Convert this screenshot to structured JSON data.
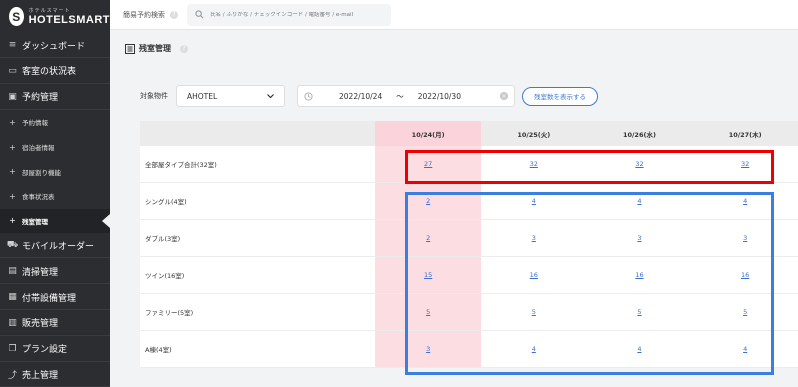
{
  "app": {
    "logo_sub": "ホテルスマート",
    "logo_main": "HOTELSMART"
  },
  "sidebar": {
    "items": [
      {
        "label": "ダッシュボード",
        "icon": "menu-icon",
        "type": "main"
      },
      {
        "label": "客室の状況表",
        "icon": "bed-icon",
        "type": "main"
      },
      {
        "label": "予約管理",
        "icon": "calendar-icon",
        "type": "main"
      },
      {
        "label": "予約情報",
        "icon": "plus-icon",
        "type": "sub"
      },
      {
        "label": "宿泊者情報",
        "icon": "plus-icon",
        "type": "sub"
      },
      {
        "label": "部屋割り機能",
        "icon": "plus-icon",
        "type": "sub"
      },
      {
        "label": "食事状況表",
        "icon": "plus-icon",
        "type": "sub"
      },
      {
        "label": "残室管理",
        "icon": "plus-icon",
        "type": "sub",
        "active": true
      },
      {
        "label": "モバイルオーダー",
        "icon": "cart-icon",
        "type": "main"
      },
      {
        "label": "清掃管理",
        "icon": "clipboard-icon",
        "type": "main"
      },
      {
        "label": "付帯設備管理",
        "icon": "grid-icon",
        "type": "main"
      },
      {
        "label": "販売管理",
        "icon": "register-icon",
        "type": "main"
      },
      {
        "label": "プラン設定",
        "icon": "copy-icon",
        "type": "main"
      },
      {
        "label": "売上管理",
        "icon": "chart-icon",
        "type": "main"
      }
    ]
  },
  "header": {
    "quick_search_label": "簡易予約検索",
    "search_placeholder": "氏名 / ふりがな / チェックインコード / 電話番号 / e-mail"
  },
  "page": {
    "title": "残室管理"
  },
  "filters": {
    "property_label": "対象物件",
    "property_value": "AHOTEL",
    "date_from": "2022/10/24",
    "date_sep": "〜",
    "date_to": "2022/10/30",
    "show_button": "残室数を表示する"
  },
  "table": {
    "columns": [
      "10/24(月)",
      "10/25(火)",
      "10/26(水)",
      "10/27(木)"
    ],
    "rows": [
      {
        "label": "全部屋タイプ合計(32室)",
        "values": [
          "27",
          "32",
          "32",
          "32"
        ]
      },
      {
        "label": "シングル(4室)",
        "values": [
          "2",
          "4",
          "4",
          "4"
        ]
      },
      {
        "label": "ダブル(3室)",
        "values": [
          "2",
          "3",
          "3",
          "3"
        ]
      },
      {
        "label": "ツイン(16室)",
        "values": [
          "15",
          "16",
          "16",
          "16"
        ]
      },
      {
        "label": "ファミリー(5室)",
        "values": [
          "5",
          "5",
          "5",
          "5"
        ]
      },
      {
        "label": "A棟(4室)",
        "values": [
          "3",
          "4",
          "4",
          "4"
        ]
      }
    ]
  },
  "colors": {
    "sidebar_bg": "#2c2d30",
    "today_column": "#fbdde2",
    "highlight_red": "#ee0000",
    "highlight_blue": "#3a7ee0",
    "link": "#3b6fd2"
  }
}
